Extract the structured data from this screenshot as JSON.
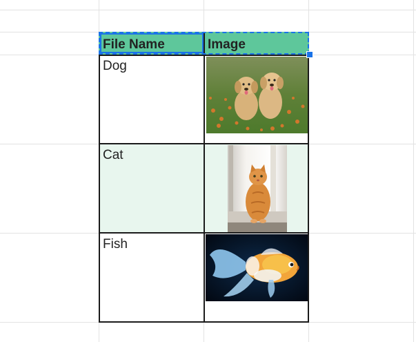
{
  "table": {
    "header": {
      "col1": "File Name",
      "col2": "Image"
    },
    "rows": [
      {
        "file_name": "Dog",
        "image": "two-puppies-photo"
      },
      {
        "file_name": "Cat",
        "image": "orange-cat-photo"
      },
      {
        "file_name": "Fish",
        "image": "goldfish-photo"
      }
    ]
  },
  "colors": {
    "header_fill": "#5ec79b",
    "alt_row_fill": "#e8f6ee",
    "selection": "#1a73e8",
    "grid": "#e2e2e2"
  }
}
